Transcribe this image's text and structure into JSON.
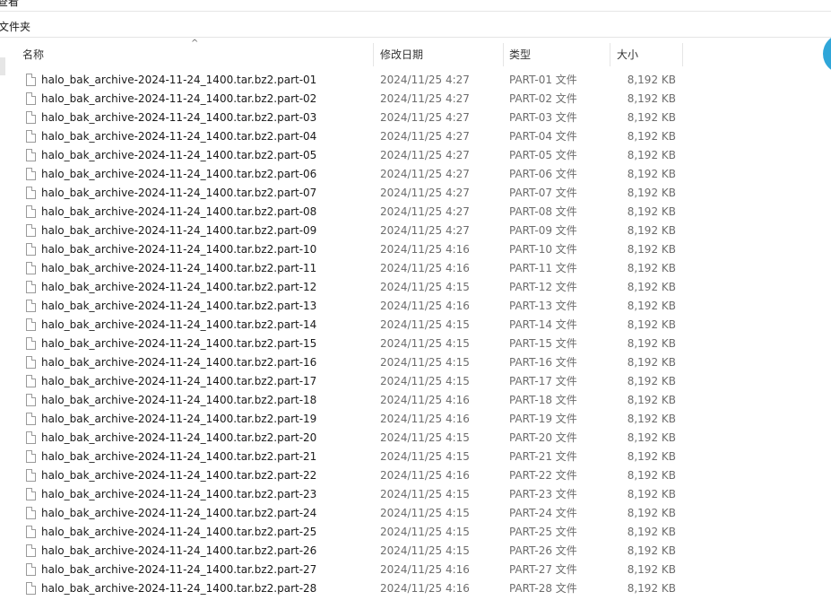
{
  "window": {
    "top_title_fragment": "查看"
  },
  "toolbar": {
    "new_folder_fragment": "文件夹"
  },
  "columns": {
    "name": "名称",
    "date": "修改日期",
    "type": "类型",
    "size": "大小",
    "sort_indicator": "^"
  },
  "files": [
    {
      "name": "halo_bak_archive-2024-11-24_1400.tar.bz2.part-01",
      "date": "2024/11/25 4:27",
      "type": "PART-01 文件",
      "size": "8,192 KB"
    },
    {
      "name": "halo_bak_archive-2024-11-24_1400.tar.bz2.part-02",
      "date": "2024/11/25 4:27",
      "type": "PART-02 文件",
      "size": "8,192 KB"
    },
    {
      "name": "halo_bak_archive-2024-11-24_1400.tar.bz2.part-03",
      "date": "2024/11/25 4:27",
      "type": "PART-03 文件",
      "size": "8,192 KB"
    },
    {
      "name": "halo_bak_archive-2024-11-24_1400.tar.bz2.part-04",
      "date": "2024/11/25 4:27",
      "type": "PART-04 文件",
      "size": "8,192 KB"
    },
    {
      "name": "halo_bak_archive-2024-11-24_1400.tar.bz2.part-05",
      "date": "2024/11/25 4:27",
      "type": "PART-05 文件",
      "size": "8,192 KB"
    },
    {
      "name": "halo_bak_archive-2024-11-24_1400.tar.bz2.part-06",
      "date": "2024/11/25 4:27",
      "type": "PART-06 文件",
      "size": "8,192 KB"
    },
    {
      "name": "halo_bak_archive-2024-11-24_1400.tar.bz2.part-07",
      "date": "2024/11/25 4:27",
      "type": "PART-07 文件",
      "size": "8,192 KB"
    },
    {
      "name": "halo_bak_archive-2024-11-24_1400.tar.bz2.part-08",
      "date": "2024/11/25 4:27",
      "type": "PART-08 文件",
      "size": "8,192 KB"
    },
    {
      "name": "halo_bak_archive-2024-11-24_1400.tar.bz2.part-09",
      "date": "2024/11/25 4:27",
      "type": "PART-09 文件",
      "size": "8,192 KB"
    },
    {
      "name": "halo_bak_archive-2024-11-24_1400.tar.bz2.part-10",
      "date": "2024/11/25 4:16",
      "type": "PART-10 文件",
      "size": "8,192 KB"
    },
    {
      "name": "halo_bak_archive-2024-11-24_1400.tar.bz2.part-11",
      "date": "2024/11/25 4:16",
      "type": "PART-11 文件",
      "size": "8,192 KB"
    },
    {
      "name": "halo_bak_archive-2024-11-24_1400.tar.bz2.part-12",
      "date": "2024/11/25 4:15",
      "type": "PART-12 文件",
      "size": "8,192 KB"
    },
    {
      "name": "halo_bak_archive-2024-11-24_1400.tar.bz2.part-13",
      "date": "2024/11/25 4:16",
      "type": "PART-13 文件",
      "size": "8,192 KB"
    },
    {
      "name": "halo_bak_archive-2024-11-24_1400.tar.bz2.part-14",
      "date": "2024/11/25 4:15",
      "type": "PART-14 文件",
      "size": "8,192 KB"
    },
    {
      "name": "halo_bak_archive-2024-11-24_1400.tar.bz2.part-15",
      "date": "2024/11/25 4:15",
      "type": "PART-15 文件",
      "size": "8,192 KB"
    },
    {
      "name": "halo_bak_archive-2024-11-24_1400.tar.bz2.part-16",
      "date": "2024/11/25 4:15",
      "type": "PART-16 文件",
      "size": "8,192 KB"
    },
    {
      "name": "halo_bak_archive-2024-11-24_1400.tar.bz2.part-17",
      "date": "2024/11/25 4:15",
      "type": "PART-17 文件",
      "size": "8,192 KB"
    },
    {
      "name": "halo_bak_archive-2024-11-24_1400.tar.bz2.part-18",
      "date": "2024/11/25 4:16",
      "type": "PART-18 文件",
      "size": "8,192 KB"
    },
    {
      "name": "halo_bak_archive-2024-11-24_1400.tar.bz2.part-19",
      "date": "2024/11/25 4:16",
      "type": "PART-19 文件",
      "size": "8,192 KB"
    },
    {
      "name": "halo_bak_archive-2024-11-24_1400.tar.bz2.part-20",
      "date": "2024/11/25 4:15",
      "type": "PART-20 文件",
      "size": "8,192 KB"
    },
    {
      "name": "halo_bak_archive-2024-11-24_1400.tar.bz2.part-21",
      "date": "2024/11/25 4:15",
      "type": "PART-21 文件",
      "size": "8,192 KB"
    },
    {
      "name": "halo_bak_archive-2024-11-24_1400.tar.bz2.part-22",
      "date": "2024/11/25 4:16",
      "type": "PART-22 文件",
      "size": "8,192 KB"
    },
    {
      "name": "halo_bak_archive-2024-11-24_1400.tar.bz2.part-23",
      "date": "2024/11/25 4:15",
      "type": "PART-23 文件",
      "size": "8,192 KB"
    },
    {
      "name": "halo_bak_archive-2024-11-24_1400.tar.bz2.part-24",
      "date": "2024/11/25 4:15",
      "type": "PART-24 文件",
      "size": "8,192 KB"
    },
    {
      "name": "halo_bak_archive-2024-11-24_1400.tar.bz2.part-25",
      "date": "2024/11/25 4:15",
      "type": "PART-25 文件",
      "size": "8,192 KB"
    },
    {
      "name": "halo_bak_archive-2024-11-24_1400.tar.bz2.part-26",
      "date": "2024/11/25 4:15",
      "type": "PART-26 文件",
      "size": "8,192 KB"
    },
    {
      "name": "halo_bak_archive-2024-11-24_1400.tar.bz2.part-27",
      "date": "2024/11/25 4:16",
      "type": "PART-27 文件",
      "size": "8,192 KB"
    },
    {
      "name": "halo_bak_archive-2024-11-24_1400.tar.bz2.part-28",
      "date": "2024/11/25 4:16",
      "type": "PART-28 文件",
      "size": "8,192 KB"
    }
  ],
  "icons": {
    "file": "file-icon",
    "sort": "sort-up-icon"
  },
  "colors": {
    "accent": "#2fa6d9",
    "secondary_text": "#6d6d6d",
    "divider": "#e5e5e5"
  }
}
